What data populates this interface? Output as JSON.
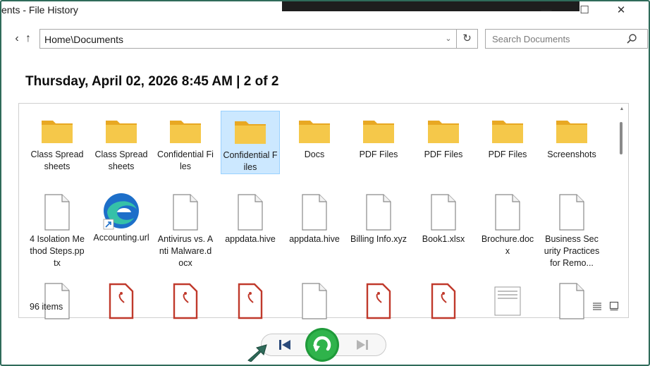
{
  "window": {
    "title": "ents - File History",
    "minimize_glyph": "—",
    "maximize_glyph": "☐",
    "close_glyph": "✕"
  },
  "nav": {
    "back_glyph": "‹",
    "up_glyph": "↑",
    "address": "Home\\Documents",
    "address_chevron": "⌄",
    "refresh_glyph": "↻",
    "search_placeholder": "Search Documents"
  },
  "header": {
    "datetime": "Thursday, April 02, 2026 8:45 AM",
    "separator": " | ",
    "position": "2 of 2"
  },
  "files": {
    "row1": [
      {
        "label": "Class Spreadsheets",
        "icon": "folder-icon"
      },
      {
        "label": "Class Spreadsheets",
        "icon": "folder-icon"
      },
      {
        "label": "Confidential Files",
        "icon": "folder-icon"
      },
      {
        "label": "Confidential Files",
        "icon": "folder-icon",
        "selected": true
      },
      {
        "label": "Docs",
        "icon": "folder-icon"
      },
      {
        "label": "PDF Files",
        "icon": "folder-icon"
      },
      {
        "label": "PDF Files",
        "icon": "folder-icon"
      },
      {
        "label": "PDF Files",
        "icon": "folder-icon"
      },
      {
        "label": "Screenshots",
        "icon": "folder-icon"
      }
    ],
    "row2": [
      {
        "label": "4 Isolation Method Steps.pptx",
        "icon": "file-icon"
      },
      {
        "label": "Accounting.url",
        "icon": "edge-icon"
      },
      {
        "label": "Antivirus vs. Anti Malware.docx",
        "icon": "file-icon"
      },
      {
        "label": "appdata.hive",
        "icon": "file-icon"
      },
      {
        "label": "appdata.hive",
        "icon": "file-icon"
      },
      {
        "label": "Billing Info.xyz",
        "icon": "file-icon"
      },
      {
        "label": "Book1.xlsx",
        "icon": "file-icon"
      },
      {
        "label": "Brochure.docx",
        "icon": "file-icon"
      },
      {
        "label": "Business Security Practices for Remo...",
        "icon": "file-icon"
      }
    ],
    "row3": [
      {
        "icon": "file-icon"
      },
      {
        "icon": "pdf-icon"
      },
      {
        "icon": "pdf-icon"
      },
      {
        "icon": "pdf-icon"
      },
      {
        "icon": "file-icon"
      },
      {
        "icon": "pdf-icon"
      },
      {
        "icon": "pdf-icon"
      },
      {
        "icon": "document-lines-icon"
      },
      {
        "icon": "file-icon"
      }
    ]
  },
  "status": {
    "item_count": "96 items"
  },
  "colors": {
    "folder": "#f5c84a",
    "folder_dark": "#e8a823",
    "selection": "#cce8ff",
    "restore_green": "#1f9a3a",
    "pdf_red": "#c0392b",
    "nav_blue": "#2b4a7a",
    "frame": "#2f6b5a"
  }
}
